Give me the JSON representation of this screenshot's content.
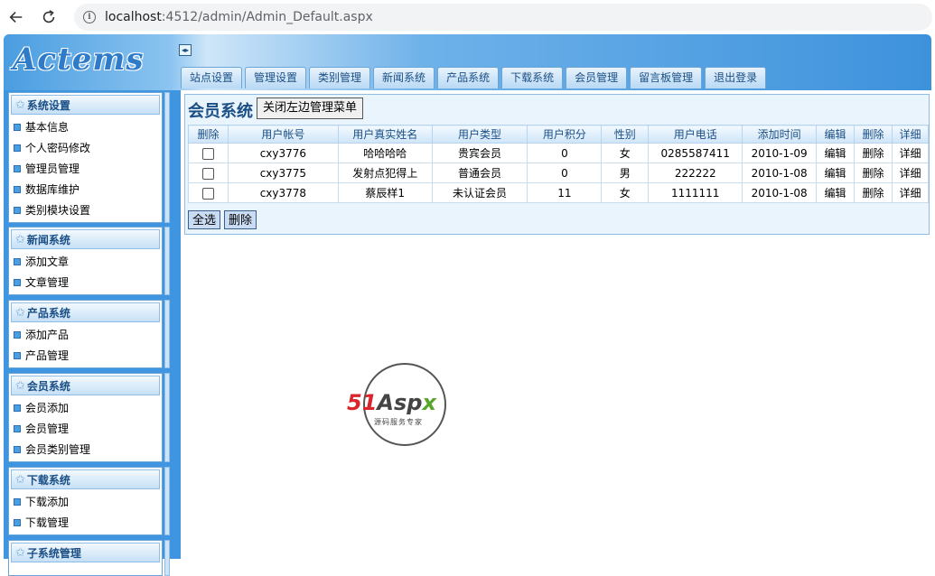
{
  "browser": {
    "url_host": "localhost",
    "url_path": ":4512/admin/Admin_Default.aspx"
  },
  "header": {
    "logo": "Actems",
    "tabs": [
      "站点设置",
      "管理设置",
      "类别管理",
      "新闻系统",
      "产品系统",
      "下载系统",
      "会员管理",
      "留言板管理",
      "退出登录"
    ]
  },
  "sidebar": {
    "groups": [
      {
        "title": "系统设置",
        "items": [
          "基本信息",
          "个人密码修改",
          "管理员管理",
          "数据库维护",
          "类别模块设置"
        ]
      },
      {
        "title": "新闻系统",
        "items": [
          "添加文章",
          "文章管理"
        ]
      },
      {
        "title": "产品系统",
        "items": [
          "添加产品",
          "产品管理"
        ]
      },
      {
        "title": "会员系统",
        "items": [
          "会员添加",
          "会员管理",
          "会员类别管理"
        ]
      },
      {
        "title": "下载系统",
        "items": [
          "下载添加",
          "下载管理"
        ]
      },
      {
        "title": "子系统管理",
        "items": []
      }
    ]
  },
  "main": {
    "title": "会员系统",
    "close_menu_label": "关闭左边管理菜单",
    "columns": [
      "删除",
      "用户帐号",
      "用户真实姓名",
      "用户类型",
      "用户积分",
      "性别",
      "用户电话",
      "添加时间",
      "编辑",
      "删除",
      "详细"
    ],
    "rows": [
      {
        "account": "cxy3776",
        "name": "哈哈哈哈",
        "type": "贵宾会员",
        "points": "0",
        "gender": "女",
        "phone": "0285587411",
        "date": "2010-1-09",
        "edit": "编辑",
        "delete": "删除",
        "detail": "详细"
      },
      {
        "account": "cxy3775",
        "name": "发射点犯得上",
        "type": "普通会员",
        "points": "0",
        "gender": "男",
        "phone": "222222",
        "date": "2010-1-08",
        "edit": "编辑",
        "delete": "删除",
        "detail": "详细"
      },
      {
        "account": "cxy3778",
        "name": "蔡辰样1",
        "type": "未认证会员",
        "points": "11",
        "gender": "女",
        "phone": "1111111",
        "date": "2010-1-08",
        "edit": "编辑",
        "delete": "删除",
        "detail": "详细"
      }
    ],
    "select_all_label": "全选",
    "delete_label": "删除"
  },
  "watermark": {
    "brand": "51Aspx",
    "tagline": "源码服务专家"
  }
}
